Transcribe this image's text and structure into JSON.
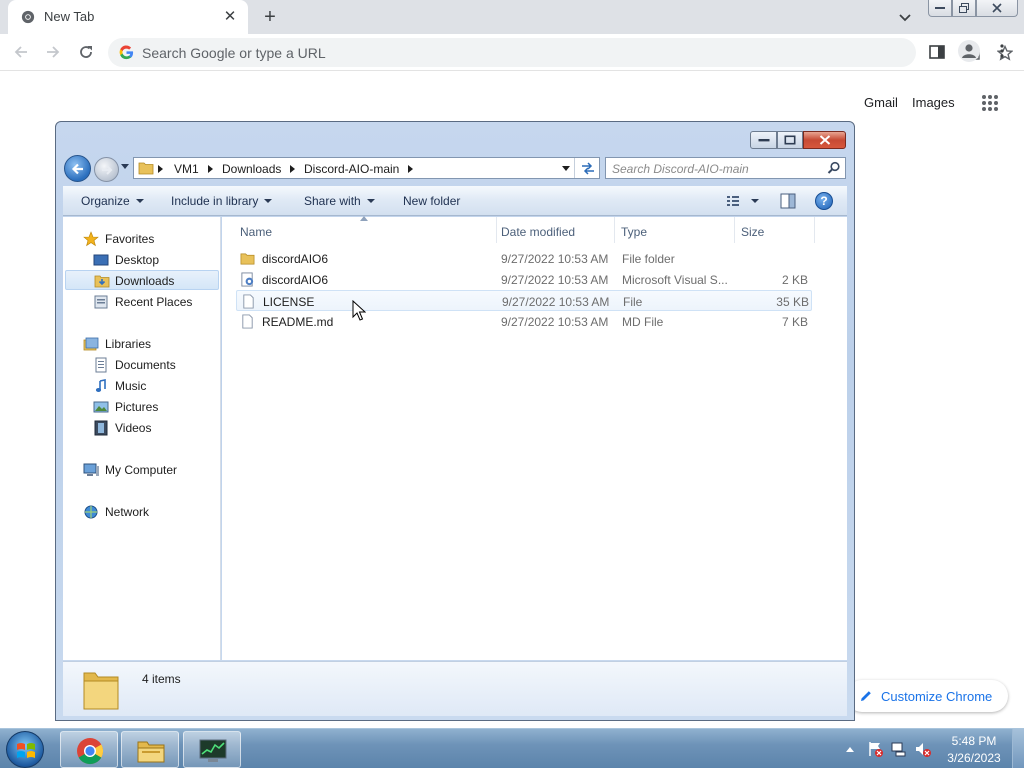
{
  "chrome": {
    "tab_title": "New Tab",
    "omnibox_placeholder": "Search Google or type a URL",
    "gmail": "Gmail",
    "images": "Images",
    "customize": "Customize Chrome"
  },
  "explorer": {
    "breadcrumbs": [
      "VM1",
      "Downloads",
      "Discord-AIO-main"
    ],
    "search_placeholder": "Search Discord-AIO-main",
    "commands": {
      "organize": "Organize",
      "include": "Include in library",
      "share": "Share with",
      "new_folder": "New folder"
    },
    "nav": {
      "favorites": "Favorites",
      "desktop": "Desktop",
      "downloads": "Downloads",
      "recent": "Recent Places",
      "libraries": "Libraries",
      "documents": "Documents",
      "music": "Music",
      "pictures": "Pictures",
      "videos": "Videos",
      "computer": "My Computer",
      "network": "Network"
    },
    "columns": [
      "Name",
      "Date modified",
      "Type",
      "Size"
    ],
    "files": [
      {
        "name": "discordAIO6",
        "date": "9/27/2022 10:53 AM",
        "type": "File folder",
        "size": "",
        "icon": "folder-icon"
      },
      {
        "name": "discordAIO6",
        "date": "9/27/2022 10:53 AM",
        "type": "Microsoft Visual S...",
        "size": "2 KB",
        "icon": "solution-file-icon"
      },
      {
        "name": "LICENSE",
        "date": "9/27/2022 10:53 AM",
        "type": "File",
        "size": "35 KB",
        "icon": "file-icon"
      },
      {
        "name": "README.md",
        "date": "9/27/2022 10:53 AM",
        "type": "MD File",
        "size": "7 KB",
        "icon": "file-icon"
      }
    ],
    "item_count": "4 items"
  },
  "taskbar": {
    "time": "5:48 PM",
    "date": "3/26/2023"
  }
}
